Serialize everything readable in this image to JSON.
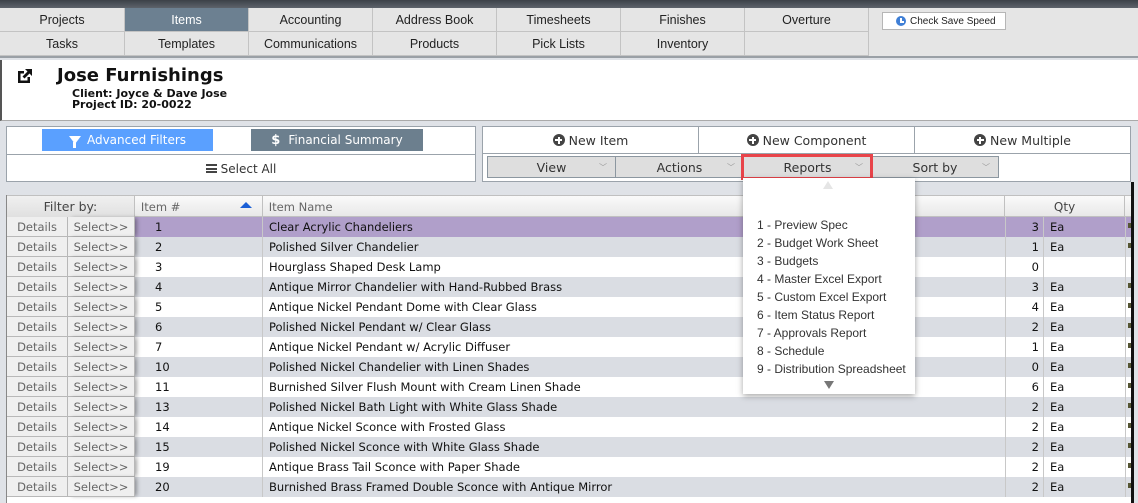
{
  "nav": {
    "row1": [
      "Projects",
      "Items",
      "Accounting",
      "Address Book",
      "Timesheets",
      "Finishes",
      "Overture"
    ],
    "row2": [
      "Tasks",
      "Templates",
      "Communications",
      "Products",
      "Pick Lists",
      "Inventory",
      ""
    ],
    "active": "Items",
    "check_save_speed": "Check Save Speed"
  },
  "project": {
    "title": "Jose Furnishings",
    "client": "Client: Joyce & Dave Jose",
    "project_id": "Project ID: 20-0022"
  },
  "toolbar": {
    "advanced_filters": "Advanced Filters",
    "financial_summary": "Financial Summary",
    "financial_icon": "$",
    "select_all": "Select All",
    "new_item": "New Item",
    "new_component": "New Component",
    "new_multiple": "New Multiple",
    "view": "View",
    "actions": "Actions",
    "reports": "Reports",
    "sort_by": "Sort by",
    "chevron": "﹀"
  },
  "grid": {
    "headers": {
      "filter_by": "Filter by:",
      "item_no": "Item #",
      "item_name": "Item Name",
      "qty": "Qty"
    },
    "details_label": "Details",
    "select_label": "Select>>",
    "rows": [
      {
        "no": "1",
        "name": "Clear Acrylic Chandeliers",
        "qty": "3",
        "unit": "Ea",
        "selected": true
      },
      {
        "no": "2",
        "name": "Polished Silver Chandelier",
        "qty": "1",
        "unit": "Ea"
      },
      {
        "no": "3",
        "name": "Hourglass Shaped Desk Lamp",
        "qty": "0",
        "unit": ""
      },
      {
        "no": "4",
        "name": "Antique Mirror Chandelier with Hand-Rubbed Brass",
        "qty": "3",
        "unit": "Ea"
      },
      {
        "no": "5",
        "name": "Antique Nickel Pendant Dome with Clear Glass",
        "qty": "4",
        "unit": "Ea"
      },
      {
        "no": "6",
        "name": "Polished Nickel Pendant w/ Clear Glass",
        "qty": "2",
        "unit": "Ea"
      },
      {
        "no": "7",
        "name": "Antique Nickel Pendant w/ Acrylic Diffuser",
        "qty": "1",
        "unit": "Ea"
      },
      {
        "no": "10",
        "name": "Polished Nickel Chandelier with Linen Shades",
        "qty": "0",
        "unit": "Ea"
      },
      {
        "no": "11",
        "name": "Burnished Silver Flush Mount with Cream Linen Shade",
        "qty": "6",
        "unit": "Ea"
      },
      {
        "no": "13",
        "name": "Polished Nickel Bath Light with White Glass Shade",
        "qty": "2",
        "unit": "Ea"
      },
      {
        "no": "14",
        "name": "Antique Nickel Sconce with Frosted Glass",
        "qty": "2",
        "unit": "Ea"
      },
      {
        "no": "15",
        "name": "Polished Nickel Sconce with White Glass Shade",
        "qty": "2",
        "unit": "Ea"
      },
      {
        "no": "19",
        "name": "Antique Brass Tail Sconce with Paper Shade",
        "qty": "2",
        "unit": "Ea"
      },
      {
        "no": "20",
        "name": "Burnished Brass Framed Double Sconce with Antique Mirror",
        "qty": "2",
        "unit": "Ea"
      }
    ]
  },
  "reports_menu": {
    "items": [
      "1 - Preview Spec",
      "2 - Budget Work Sheet",
      "3 - Budgets",
      "4 - Master Excel Export",
      "5 - Custom Excel Export",
      "6 - Item Status Report",
      "7 - Approvals Report",
      "8 - Schedule",
      "9 - Distribution Spreadsheet"
    ]
  },
  "colors": {
    "active_tab": "#6c8091",
    "advanced_filters": "#5aa0ff",
    "financial_summary": "#6c7f8e",
    "selected_row": "#b09fca",
    "highlight_outline": "#e8444a",
    "sort_arrow": "#1a5fd6"
  }
}
